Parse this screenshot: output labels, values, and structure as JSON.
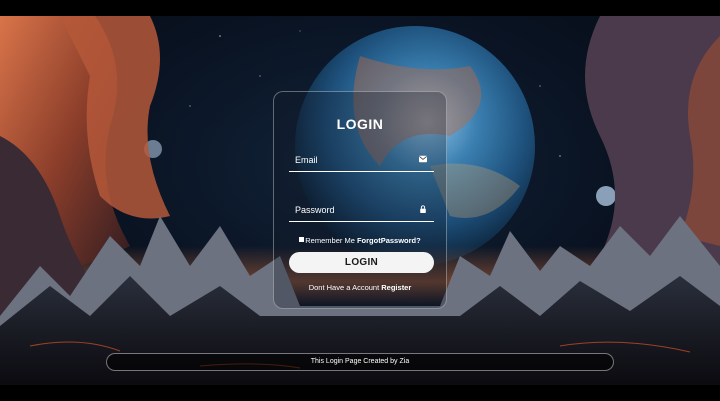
{
  "login_card": {
    "title": "LOGIN",
    "email": {
      "placeholder": "Email",
      "icon": "envelope-icon"
    },
    "password": {
      "placeholder": "Password",
      "icon": "lock-icon"
    },
    "remember_label": "Remember Me",
    "forgot_label": "ForgotPassword?",
    "login_button": "LOGIN",
    "no_account_text": "Dont Have a Account",
    "register_link": "Register"
  },
  "footer": {
    "credit": "This Login Page Created by Zia"
  },
  "colors": {
    "text": "#ffffff",
    "button_bg": "#f4f4f4",
    "button_text": "#1a1a1a",
    "planet_blue": "#3a7fb0",
    "rock_orange": "#c4603a"
  }
}
